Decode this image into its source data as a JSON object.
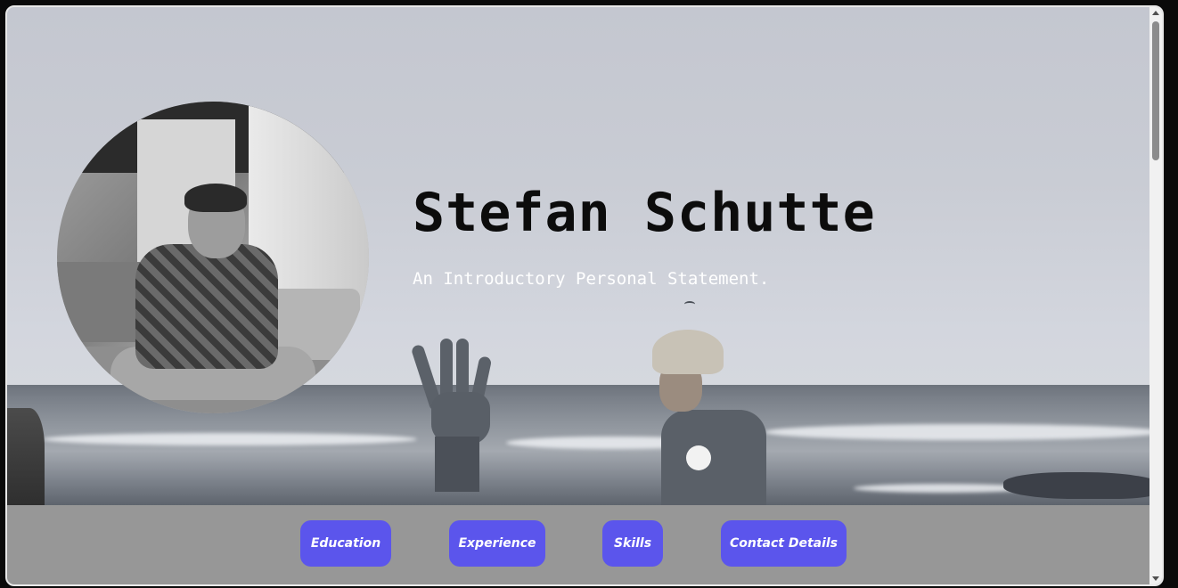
{
  "hero": {
    "name": "Stefan Schutte",
    "tagline": "An Introductory Personal Statement."
  },
  "nav": {
    "items": [
      {
        "label": "Education"
      },
      {
        "label": "Experience"
      },
      {
        "label": "Skills"
      },
      {
        "label": "Contact Details"
      }
    ]
  },
  "colors": {
    "button_bg": "#5b55ec",
    "navbar_bg": "#979797",
    "title_color": "#0c0c0c",
    "tagline_color": "#ffffff"
  },
  "icons": {
    "scroll_up": "chevron-up-icon",
    "scroll_down": "chevron-down-icon"
  }
}
